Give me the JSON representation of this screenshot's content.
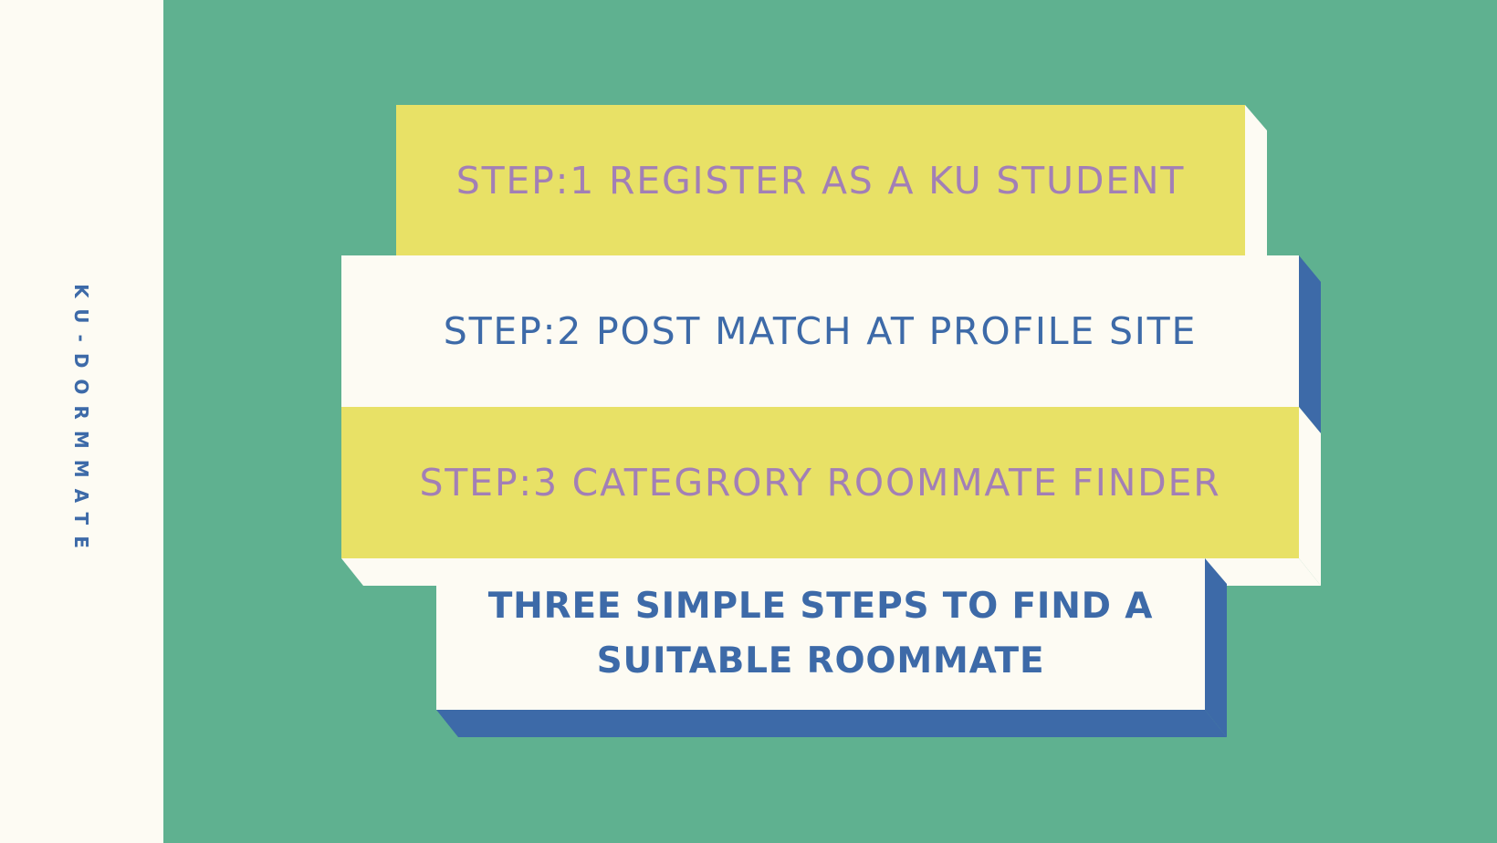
{
  "brand": {
    "name": "KU-DORMMATE"
  },
  "steps": [
    {
      "label": "STEP:1 REGISTER AS A KU STUDENT"
    },
    {
      "label": "STEP:2 POST MATCH AT PROFILE SITE"
    },
    {
      "label": "STEP:3 CATEGRORY ROOMMATE FINDER"
    }
  ],
  "tagline": {
    "line1": "THREE SIMPLE STEPS TO FIND A",
    "line2": "SUITABLE ROOMMATE"
  },
  "colors": {
    "background": "#5fb190",
    "sidebar": "#fdfbf3",
    "yellow": "#e8e166",
    "cream": "#fdfbf3",
    "blue": "#3d6aa8",
    "purple": "#a27fb6"
  }
}
